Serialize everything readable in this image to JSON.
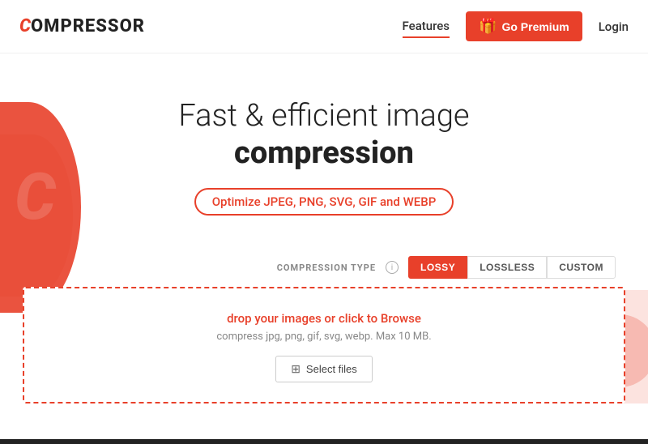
{
  "brand": {
    "logo_c": "C",
    "logo_rest": "OMPRESSOR"
  },
  "nav": {
    "features_label": "Features",
    "premium_label": "Go Premium",
    "premium_emoji": "🎁",
    "login_label": "Login"
  },
  "hero": {
    "title_line1": "Fast & efficient image",
    "title_line2": "compression",
    "subtitle": "Optimize JPEG, PNG, SVG, GIF and WEBP"
  },
  "compression": {
    "type_label": "COMPRESSION TYPE",
    "info_icon": "i",
    "types": [
      {
        "label": "LOSSY",
        "active": true
      },
      {
        "label": "LOSSLESS",
        "active": false
      },
      {
        "label": "CUSTOM",
        "active": false
      }
    ]
  },
  "dropzone": {
    "main_text": "drop your images or click to Browse",
    "sub_text": "compress jpg, png, gif, svg, webp. Max 10 MB.",
    "select_label": "Select files",
    "select_icon": "⊞"
  },
  "blob_letter": "C"
}
